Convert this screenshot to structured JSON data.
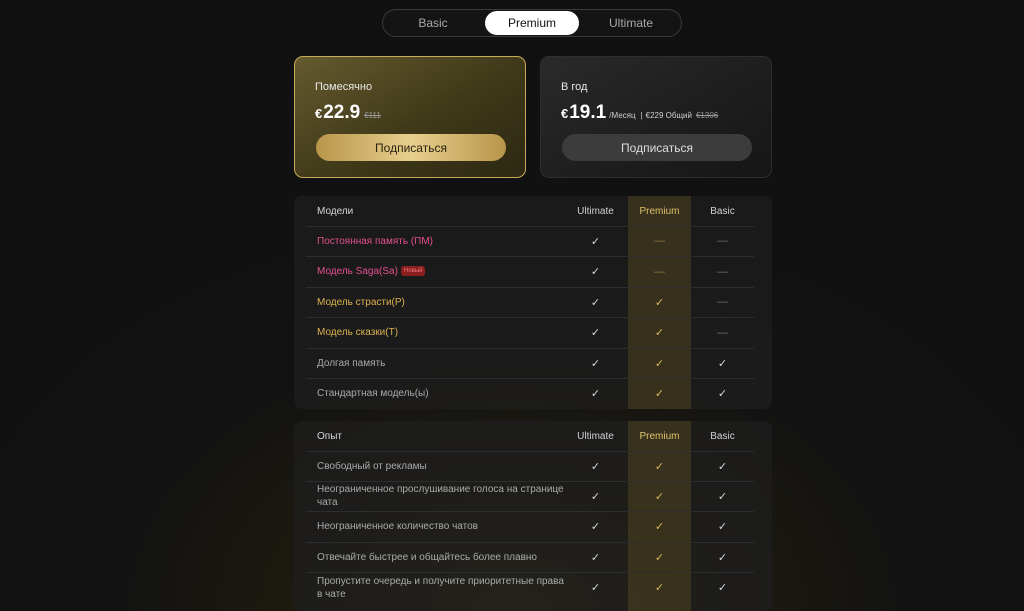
{
  "tabs": [
    {
      "label": "Basic",
      "active": false
    },
    {
      "label": "Premium",
      "active": true
    },
    {
      "label": "Ultimate",
      "active": false
    }
  ],
  "plans": {
    "monthly": {
      "title": "Помесячно",
      "currency": "€",
      "price": "22.9",
      "old_price": "€111",
      "button": "Подписаться"
    },
    "yearly": {
      "title": "В год",
      "currency": "€",
      "price": "19.1",
      "per": "/Месяц",
      "separator": "|",
      "total": "€229 Общий",
      "old_total": "€1306",
      "button": "Подписаться"
    }
  },
  "models_table": {
    "header": {
      "label": "Модели",
      "ultimate": "Ultimate",
      "premium": "Premium",
      "basic": "Basic"
    },
    "rows": [
      {
        "label": "Постоянная память (ПМ)",
        "color": "#e4508f",
        "ultimate": "✓",
        "premium": "—",
        "basic": "—"
      },
      {
        "label": "Модель Saga(Sa)",
        "badge": "Новый",
        "color": "#e4508f",
        "ultimate": "✓",
        "premium": "—",
        "basic": "—"
      },
      {
        "label": "Модель страсти(P)",
        "color": "#dcb14f",
        "ultimate": "✓",
        "premium": "✓",
        "basic": "—"
      },
      {
        "label": "Модель сказки(T)",
        "color": "#dcb14f",
        "ultimate": "✓",
        "premium": "✓",
        "basic": "—"
      },
      {
        "label": "Долгая память",
        "ultimate": "✓",
        "premium": "✓",
        "basic": "✓"
      },
      {
        "label": "Стандартная модель(ы)",
        "ultimate": "✓",
        "premium": "✓",
        "basic": "✓"
      }
    ]
  },
  "experience_table": {
    "header": {
      "label": "Опыт",
      "ultimate": "Ultimate",
      "premium": "Premium",
      "basic": "Basic"
    },
    "rows": [
      {
        "label": "Свободный от рекламы",
        "ultimate": "✓",
        "premium": "✓",
        "basic": "✓"
      },
      {
        "label": "Неограниченное прослушивание голоса на странице чата",
        "ultimate": "✓",
        "premium": "✓",
        "basic": "✓"
      },
      {
        "label": "Неограниченное количество чатов",
        "ultimate": "✓",
        "premium": "✓",
        "basic": "✓"
      },
      {
        "label": "Отвечайте быстрее и общайтесь более плавно",
        "ultimate": "✓",
        "premium": "✓",
        "basic": "✓"
      },
      {
        "label": "Пропустите очередь и получите приоритетные права в чате",
        "ultimate": "✓",
        "premium": "✓",
        "basic": "✓"
      }
    ]
  }
}
